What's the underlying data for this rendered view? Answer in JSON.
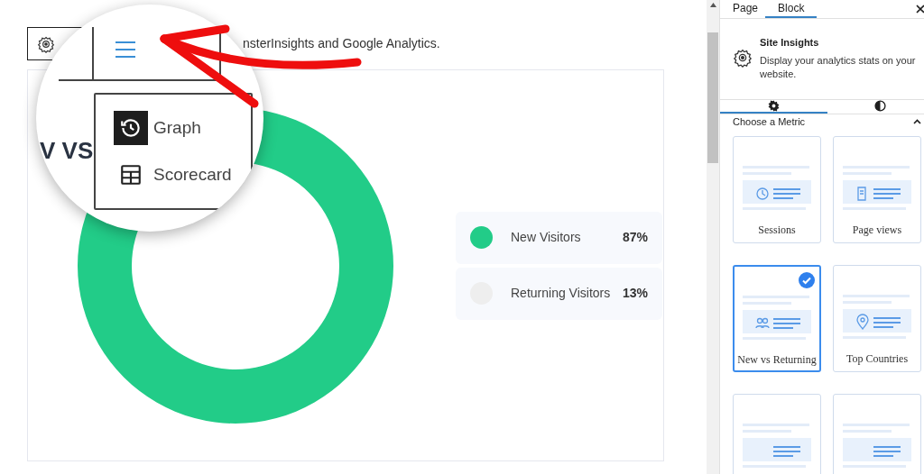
{
  "editor": {
    "caption_text": "nsterInsights and Google Analytics.",
    "magnifier": {
      "heading_fragment": "V VS",
      "menu": [
        {
          "label": "Graph",
          "kind": "history",
          "selected": true
        },
        {
          "label": "Scorecard",
          "kind": "table",
          "selected": false
        }
      ]
    },
    "chart": {
      "legend": [
        {
          "label": "New Visitors",
          "value": "87%",
          "color": "#22cc88"
        },
        {
          "label": "Returning Visitors",
          "value": "13%",
          "color": "#eeeeee"
        }
      ]
    }
  },
  "sidebar": {
    "tabs": [
      {
        "label": "Page",
        "selected": false
      },
      {
        "label": "Block",
        "selected": true
      }
    ],
    "block": {
      "title": "Site Insights",
      "description": "Display your analytics stats on your website."
    },
    "panel_tabs": [
      {
        "kind": "settings",
        "selected": true
      },
      {
        "kind": "styles",
        "selected": false
      }
    ],
    "section": {
      "title": "Choose a Metric",
      "expanded": true
    },
    "metrics": [
      {
        "label": "Sessions",
        "kind": "clock",
        "selected": false
      },
      {
        "label": "Page views",
        "kind": "document",
        "selected": false
      },
      {
        "label": "New vs Returning",
        "kind": "people",
        "selected": true
      },
      {
        "label": "Top Countries",
        "kind": "pin",
        "selected": false
      },
      {
        "kind": "lines",
        "selected": false
      },
      {
        "kind": "lines",
        "selected": false
      }
    ]
  }
}
